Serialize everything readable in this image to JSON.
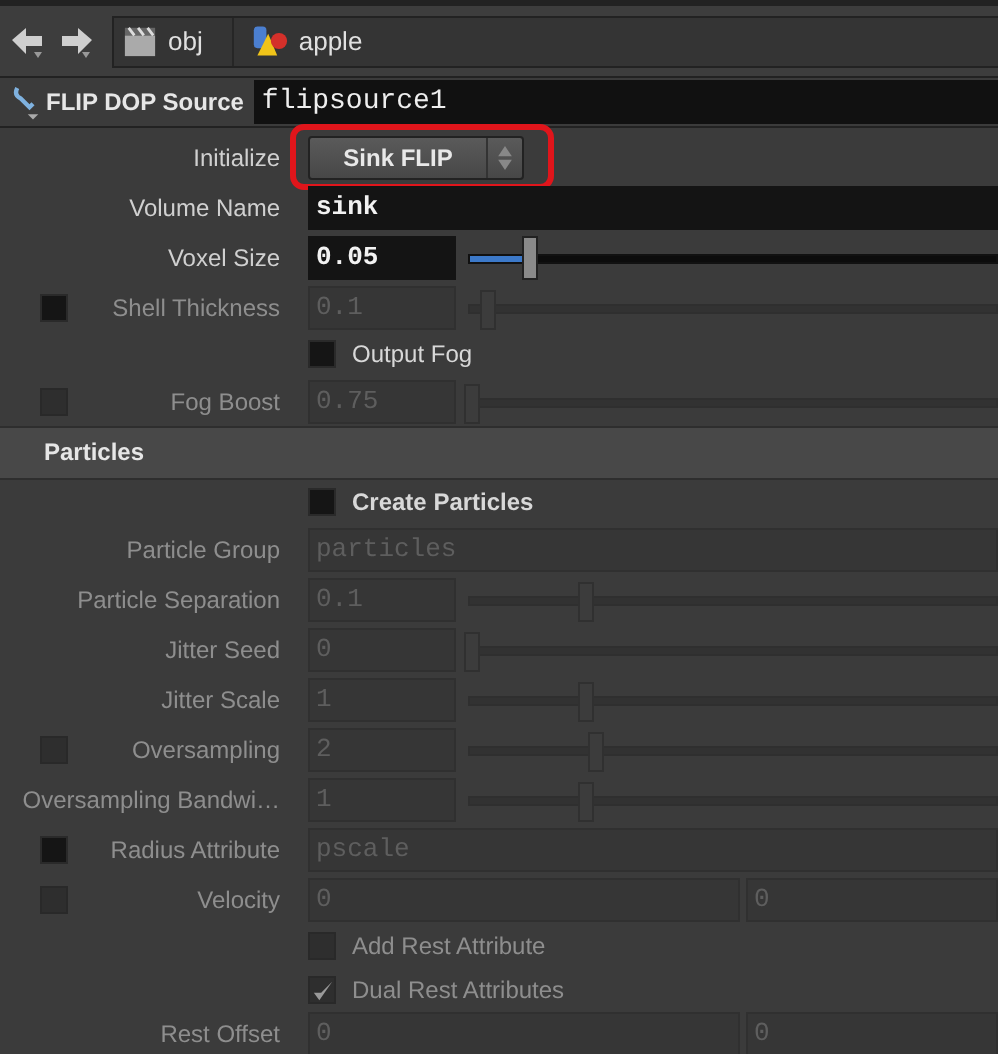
{
  "toolbar": {
    "path": [
      {
        "label": "obj",
        "kind": "folder"
      },
      {
        "label": "apple",
        "kind": "geo"
      }
    ]
  },
  "node": {
    "type": "FLIP DOP Source",
    "name": "flipsource1"
  },
  "params": [
    {
      "kind": "menu",
      "label": "Initialize",
      "value": "Sink FLIP",
      "highlighted": true,
      "disabled": false
    },
    {
      "kind": "string",
      "label": "Volume Name",
      "value": "sink",
      "disabled": false
    },
    {
      "kind": "slider",
      "label": "Voxel Size",
      "value": "0.05",
      "level": 0.11,
      "disabled": false
    },
    {
      "kind": "slider",
      "label": "Shell Thickness",
      "value": "0.1",
      "level": 0.03,
      "disabled": true,
      "side_toggle": {
        "checked": false,
        "disabled": false
      }
    },
    {
      "kind": "toggle",
      "label": "Output Fog",
      "checked": false,
      "disabled": false
    },
    {
      "kind": "slider",
      "label": "Fog Boost",
      "value": "0.75",
      "level": 0,
      "disabled": true,
      "side_toggle": {
        "checked": false,
        "disabled": true
      }
    },
    {
      "kind": "section",
      "label": "Particles"
    },
    {
      "kind": "toggle",
      "label": "Create Particles",
      "checked": false,
      "disabled": false,
      "bold": true
    },
    {
      "kind": "string",
      "label": "Particle Group",
      "value": "particles",
      "disabled": true
    },
    {
      "kind": "slider",
      "label": "Particle Separation",
      "value": "0.1",
      "level": 0.22,
      "disabled": true
    },
    {
      "kind": "slider",
      "label": "Jitter Seed",
      "value": "0",
      "level": 0,
      "disabled": true
    },
    {
      "kind": "slider",
      "label": "Jitter Scale",
      "value": "1",
      "level": 0.22,
      "disabled": true
    },
    {
      "kind": "slider",
      "label": "Oversampling",
      "value": "2",
      "level": 0.24,
      "disabled": true,
      "side_toggle": {
        "checked": false,
        "disabled": true
      }
    },
    {
      "kind": "slider",
      "label": "Oversampling Bandwi…",
      "value": "1",
      "level": 0.22,
      "disabled": true
    },
    {
      "kind": "string",
      "label": "Radius Attribute",
      "value": "pscale",
      "disabled": true,
      "side_toggle": {
        "checked": false,
        "disabled": false
      }
    },
    {
      "kind": "vector",
      "label": "Velocity",
      "values": [
        "0",
        "0"
      ],
      "disabled": true,
      "side_toggle": {
        "checked": false,
        "disabled": true
      }
    },
    {
      "kind": "toggle",
      "label": "Add Rest Attribute",
      "checked": false,
      "disabled": true
    },
    {
      "kind": "toggle",
      "label": "Dual Rest Attributes",
      "checked": true,
      "disabled": true
    },
    {
      "kind": "vector",
      "label": "Rest Offset",
      "values": [
        "0",
        "0"
      ],
      "disabled": true
    }
  ]
}
